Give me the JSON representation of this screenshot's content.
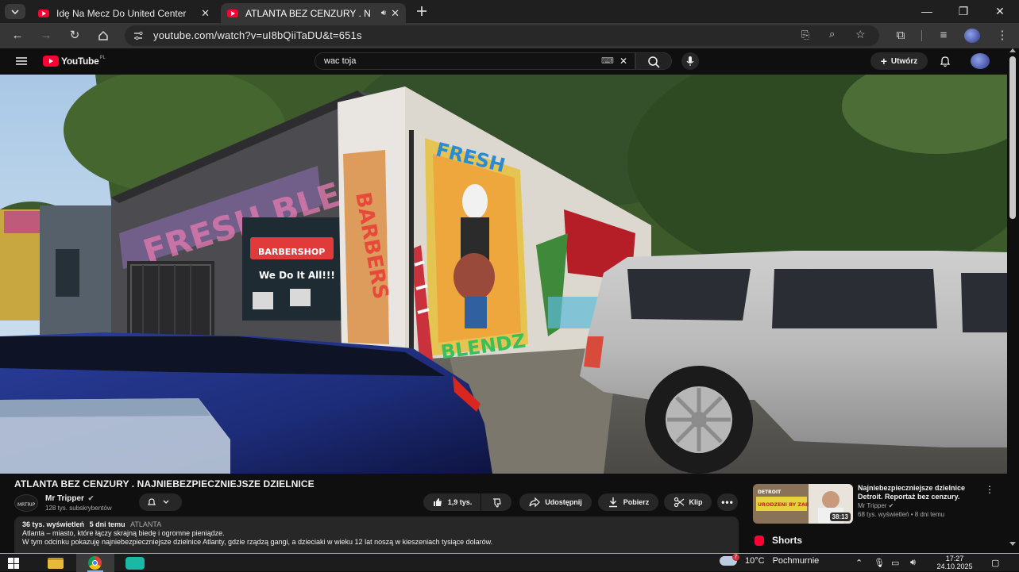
{
  "browser": {
    "tabs": [
      {
        "title": "Idę Na Mecz Do United Center",
        "active": false
      },
      {
        "title": "ATLANTA BEZ CENZURY . N",
        "active": true
      }
    ],
    "new_tab_icon": "plus-icon",
    "url": "youtube.com/watch?v=uI8bQiiTaDU&t=651s"
  },
  "youtube": {
    "logo_text": "YouTube",
    "country_code": "PL",
    "search_value": "wac toja",
    "create_label": "Utwórz"
  },
  "video": {
    "title": "ATLANTA BEZ CENZURY . NAJNIEBEZPIECZNIEJSZE DZIELNICE",
    "channel": "Mr Tripper",
    "subscribers": "128 tys. subskrybentów",
    "likes": "1,9 tys.",
    "actions": {
      "share": "Udostępnij",
      "download": "Pobierz",
      "clip": "Klip"
    },
    "views": "36 tys. wyświetleń",
    "age": "5 dni temu",
    "tag": "ATLANTA",
    "desc_line1": "Atlanta – miasto, które łączy skrajną biedę i ogromne pieniądze.",
    "desc_line2": "W tym odcinku pokazuję najniebezpieczniejsze dzielnice Atlanty, gdzie rządzą gangi, a dzieciaki w wieku 12 lat noszą w kieszeniach tysiące dolarów.",
    "scene_signs": {
      "shop_sign": "BARBERSHOP",
      "window_text": "We Do It All!!!",
      "mural_top": "FRESH",
      "mural_side": "BARBERS",
      "mural_bottom": "BLENDZ"
    }
  },
  "recommendation": {
    "title_line1": "Najniebezpieczniejsze dzielnice",
    "title_line2": "Detroit. Reportaż bez cenzury.",
    "channel": "Mr Tripper",
    "meta": "68 tys. wyświetleń • 8 dni temu",
    "duration": "38:13",
    "thumb_text_1": "DETROIT",
    "thumb_text_2": "URODZENI BY ZABIJAĆ"
  },
  "shorts_label": "Shorts",
  "taskbar": {
    "weather_temp": "10°C",
    "weather_desc": "Pochmurnie",
    "weather_badge": "7",
    "time": "17:27",
    "date": "24.10.2025"
  }
}
